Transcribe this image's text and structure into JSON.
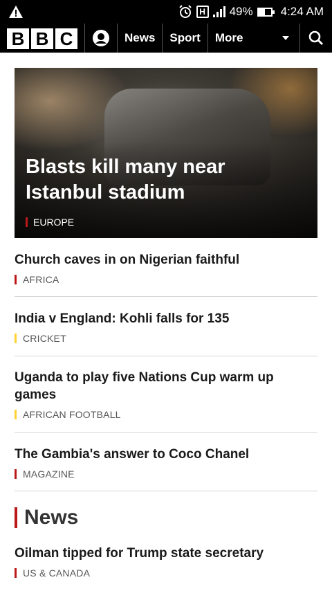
{
  "status_bar": {
    "battery": "49%",
    "time": "4:24 AM"
  },
  "nav": {
    "logo_letters": [
      "B",
      "B",
      "C"
    ],
    "items": [
      "News",
      "Sport",
      "More"
    ]
  },
  "hero": {
    "title": "Blasts kill many near Istanbul stadium",
    "tag": "EUROPE",
    "tag_color": "#bb1919"
  },
  "stories": [
    {
      "title": "Church caves in on Nigerian faithful",
      "tag": "AFRICA",
      "tag_color": "#bb1919"
    },
    {
      "title": "India v England: Kohli falls for 135",
      "tag": "CRICKET",
      "tag_color": "#ffd230"
    },
    {
      "title": "Uganda to play five Nations Cup warm up games",
      "tag": "AFRICAN FOOTBALL",
      "tag_color": "#ffd230"
    },
    {
      "title": "The Gambia's answer to Coco Chanel",
      "tag": "MAGAZINE",
      "tag_color": "#bb1919"
    }
  ],
  "section": {
    "title": "News",
    "stories": [
      {
        "title": "Oilman tipped for Trump state secretary",
        "tag": "US & CANADA",
        "tag_color": "#bb1919"
      }
    ]
  }
}
